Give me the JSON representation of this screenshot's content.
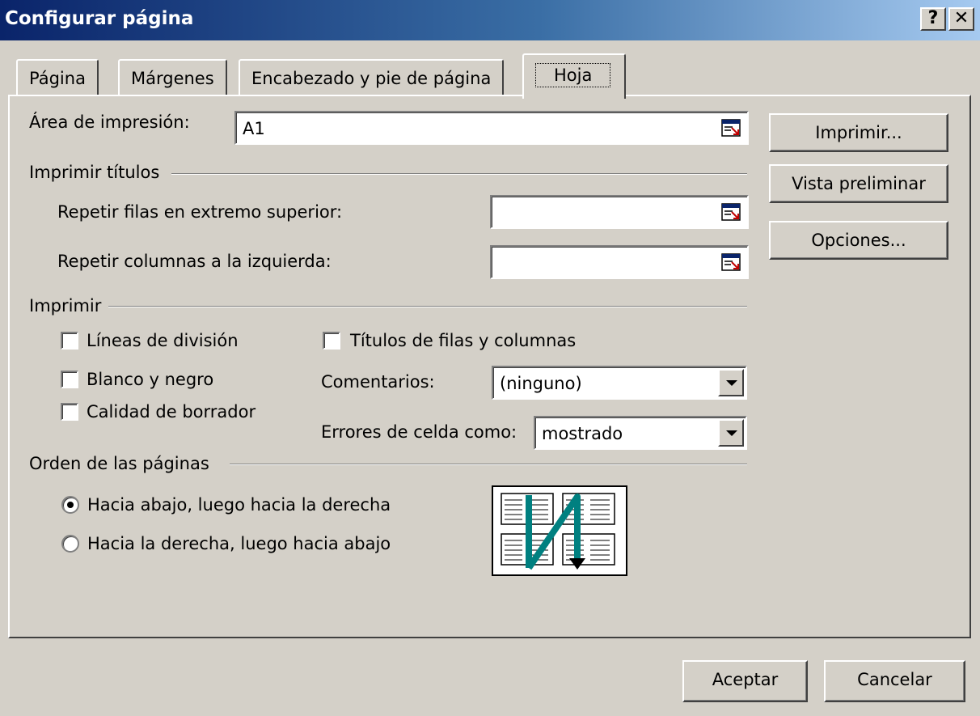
{
  "window": {
    "title": "Configurar página",
    "help_label": "?",
    "close_label": "✕"
  },
  "tabs": [
    {
      "label": "Página"
    },
    {
      "label": "Márgenes"
    },
    {
      "label": "Encabezado y pie de página"
    },
    {
      "label": "Hoja",
      "active": true
    }
  ],
  "print_area": {
    "label": "Área de impresión:",
    "value": "A1",
    "icon": "collapse-dialog-icon"
  },
  "print_titles": {
    "group_label": "Imprimir títulos",
    "rows_label": "Repetir filas en extremo superior:",
    "rows_value": "",
    "cols_label": "Repetir columnas a la izquierda:",
    "cols_value": ""
  },
  "print": {
    "group_label": "Imprimir",
    "gridlines": {
      "label": "Líneas de división",
      "checked": false
    },
    "black_white": {
      "label": "Blanco y negro",
      "checked": false
    },
    "draft": {
      "label": "Calidad de borrador",
      "checked": false
    },
    "row_col_headings": {
      "label": "Títulos de filas y columnas",
      "checked": false
    },
    "comments_label": "Comentarios:",
    "comments_value": "(ninguno)",
    "errors_label": "Errores de celda como:",
    "errors_value": "mostrado"
  },
  "page_order": {
    "group_label": "Orden de las páginas",
    "down_then_over": {
      "label": "Hacia abajo, luego hacia la derecha",
      "checked": true
    },
    "over_then_down": {
      "label": "Hacia la derecha, luego hacia abajo",
      "checked": false
    }
  },
  "side_buttons": {
    "print": "Imprimir...",
    "preview": "Vista preliminar",
    "options": "Opciones..."
  },
  "footer": {
    "ok": "Aceptar",
    "cancel": "Cancelar"
  },
  "colors": {
    "face": "#d4d0c8",
    "title_start": "#0a246a",
    "title_end": "#a6caf0",
    "arrow": "#008080"
  }
}
